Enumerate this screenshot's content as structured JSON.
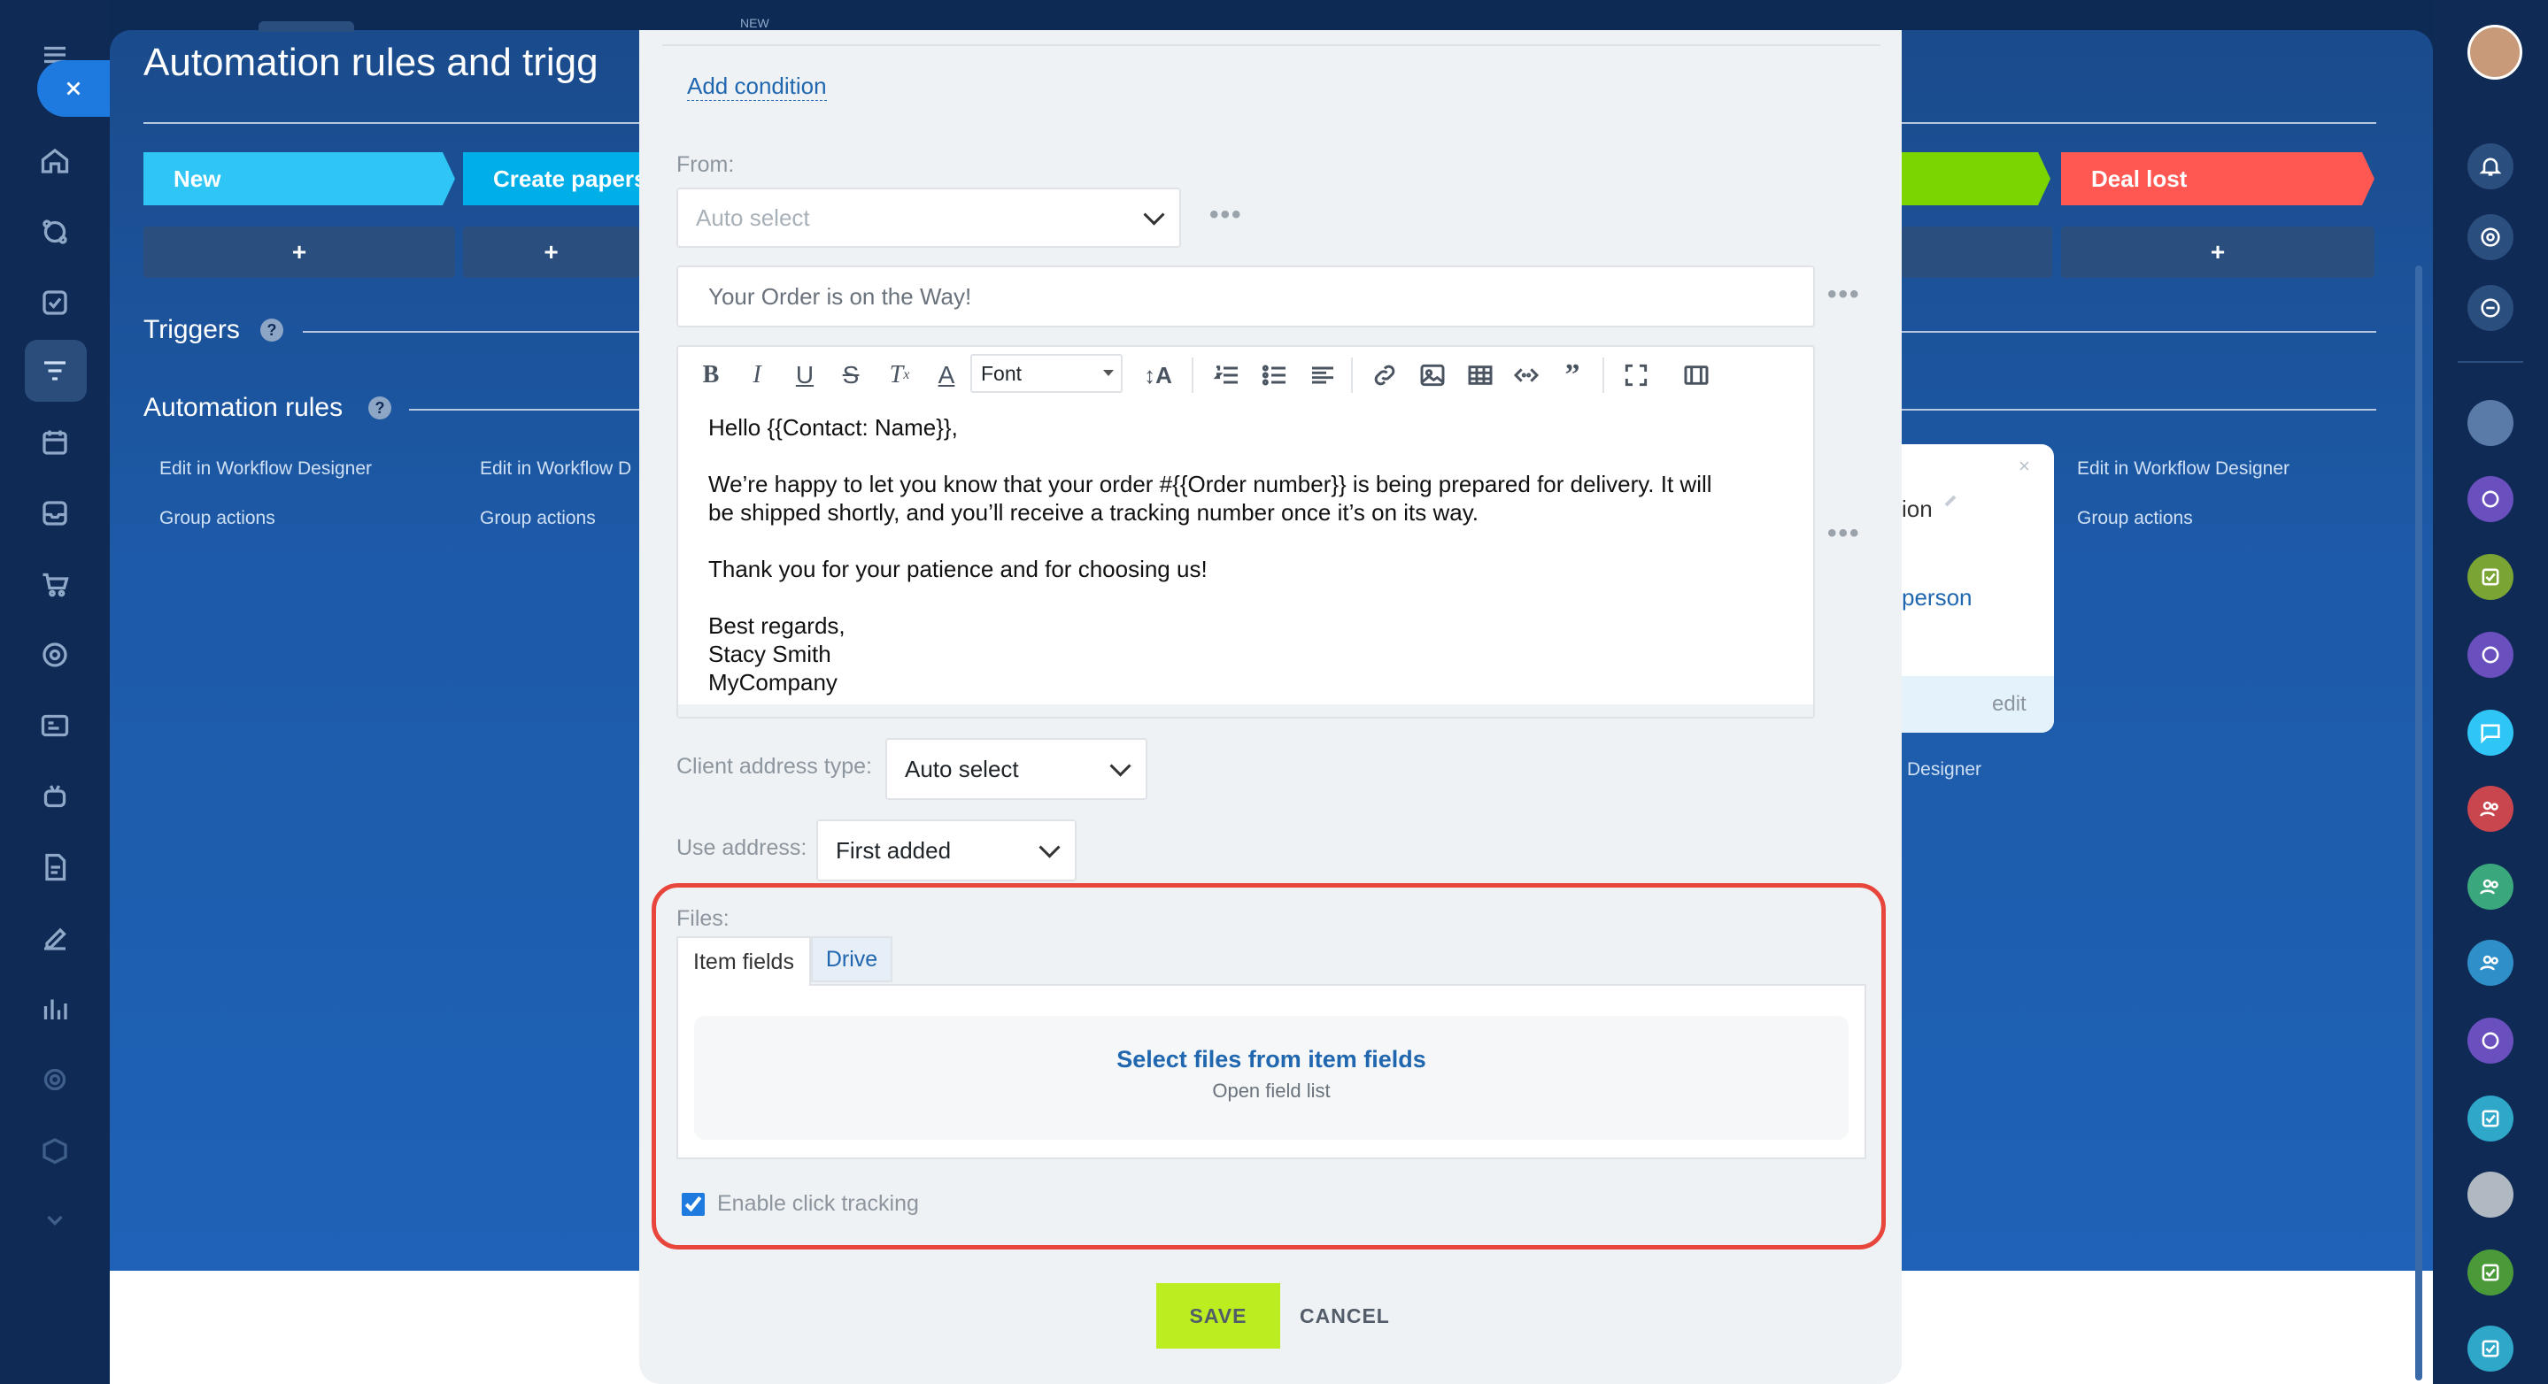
{
  "page": {
    "title": "Automation rules and trigg",
    "new_badge": "NEW"
  },
  "stages": [
    {
      "label": "New",
      "color": "#2fc6f6"
    },
    {
      "label": "Create papers",
      "color": "#00aee8"
    },
    {
      "label": "",
      "color": "#7bd500"
    },
    {
      "label": "Deal lost",
      "color": "#ff5752"
    }
  ],
  "plus_label": "+",
  "sections": {
    "triggers": "Triggers",
    "automation_rules": "Automation rules",
    "help_glyph": "?"
  },
  "column_links": {
    "edit_designer": "Edit in Workflow Designer",
    "edit_designer_cut": "Edit in Workflow D",
    "group_actions": "Group actions"
  },
  "background_card": {
    "frag_ion": "ion",
    "frag_person": "person",
    "edit": "edit",
    "designer": "Designer",
    "close": "×"
  },
  "dialog": {
    "add_condition": "Add condition",
    "from_label": "From:",
    "from_placeholder": "Auto select",
    "more_dots": "•••",
    "subject": "Your Order is on the Way!",
    "toolbar": {
      "font_select": "Font"
    },
    "email_body": {
      "greeting": "Hello {{Contact: Name}},",
      "para1_line1": "We’re happy to let you know that your order #{{Order number}} is being prepared for delivery. It will",
      "para1_line2": "be shipped shortly, and you’ll receive a tracking number once it’s on its way.",
      "para2": "Thank you for your patience and for choosing us!",
      "sign1": "Best regards,",
      "sign2": "Stacy Smith",
      "sign3": "MyCompany"
    },
    "client_address_type_label": "Client address type:",
    "client_address_type_value": "Auto select",
    "use_address_label": "Use address:",
    "use_address_value": "First added",
    "files_label": "Files:",
    "tabs": [
      {
        "label": "Item fields",
        "active": true
      },
      {
        "label": "Drive",
        "active": false
      }
    ],
    "select_files_title": "Select files from item fields",
    "select_files_sub": "Open field list",
    "click_tracking_label": "Enable click tracking",
    "click_tracking_checked": true,
    "save": "SAVE",
    "cancel": "CANCEL"
  },
  "colors": {
    "accent_link": "#2067b0",
    "save_green": "#bbed21",
    "highlight_red": "#e8453c"
  },
  "left_nav_icons": [
    "menu-icon",
    "close-icon",
    "home-icon",
    "crm-icon",
    "tasks-icon",
    "automation-icon",
    "calendar-icon",
    "inbox-icon",
    "shop-icon",
    "target-icon",
    "contact-center-icon",
    "robot-icon",
    "documents-icon",
    "sign-icon",
    "analytics-icon",
    "settings-icon",
    "box-icon",
    "chevron-down-icon"
  ],
  "right_bar_icons": [
    "avatar",
    "bell-icon",
    "target-icon",
    "chat-search-icon",
    "avatar",
    "openline-icon",
    "tasks-icon",
    "openline-icon",
    "chat-icon",
    "group-icon",
    "group-icon",
    "group-icon",
    "openline-icon",
    "tasks-icon",
    "avatar",
    "tasks-icon",
    "tasks-icon"
  ]
}
